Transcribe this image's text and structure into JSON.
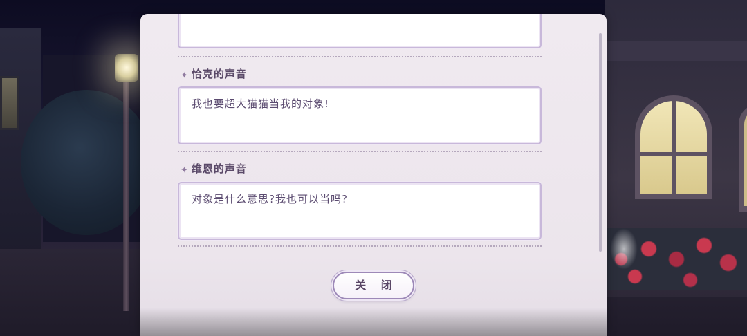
{
  "dialogues": [
    {
      "speaker": "",
      "text": ""
    },
    {
      "speaker": "恰克的声音",
      "text": "我也要超大猫猫当我的对象!"
    },
    {
      "speaker": "维恩的声音",
      "text": "对象是什么意思?我也可以当吗?"
    }
  ],
  "close_label": "关 闭",
  "icons": {
    "speaker_marker": "sparkle-icon"
  },
  "colors": {
    "panel_bg": "#efe9ef",
    "text": "#5b4b70",
    "border_accent": "#c8b8da"
  }
}
